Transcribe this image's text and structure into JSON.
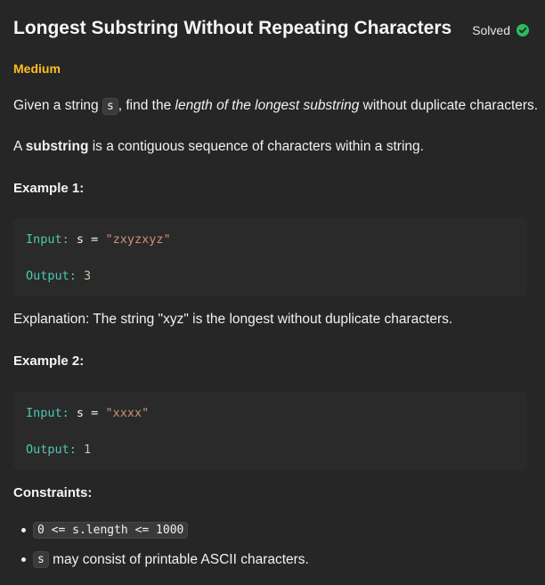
{
  "problem": {
    "title": "Longest Substring Without Repeating Characters",
    "status": "Solved",
    "difficulty": "Medium",
    "statement": {
      "prefix": "Given a string ",
      "var": "s",
      "mid": ", find the ",
      "emphasis": "length of the longest substring",
      "suffix": " without duplicate characters."
    },
    "definition": {
      "prefix": "A ",
      "bold": "substring",
      "suffix": " is a contiguous sequence of characters within a string."
    }
  },
  "examples": [
    {
      "heading": "Example 1:",
      "input_label": "Input:",
      "input_expr": "s =",
      "input_value": "\"zxyzxyz\"",
      "output_label": "Output:",
      "output_value": "3",
      "explanation": "Explanation: The string \"xyz\" is the longest without duplicate characters."
    },
    {
      "heading": "Example 2:",
      "input_label": "Input:",
      "input_expr": "s =",
      "input_value": "\"xxxx\"",
      "output_label": "Output:",
      "output_value": "1"
    }
  ],
  "constraints": {
    "heading": "Constraints:",
    "items": [
      {
        "code": "0 <= s.length <= 1000",
        "text": ""
      },
      {
        "code": "s",
        "text": " may consist of printable ASCII characters."
      }
    ]
  },
  "colors": {
    "background": "#262626",
    "difficulty_medium": "#ffc01e",
    "solved_check": "#2cbb5d",
    "code_keyword": "#4ec9b0",
    "code_string": "#ce9178",
    "code_number": "#b5cea8"
  },
  "icons": {
    "solved": "check-circle-icon",
    "bullet": "bullet-dot-icon"
  }
}
